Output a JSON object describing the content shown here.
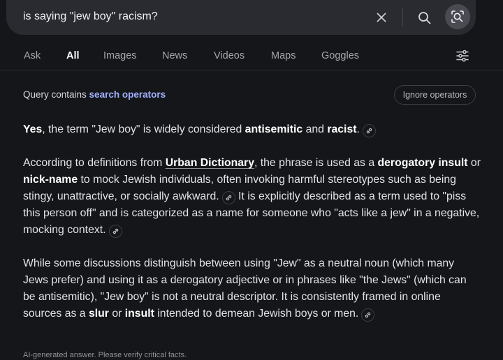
{
  "search": {
    "query": "is saying \"jew boy\" racism?",
    "icons": [
      "close-icon",
      "search-icon",
      "lens-icon"
    ]
  },
  "tabs": [
    {
      "label": "Ask",
      "active": false
    },
    {
      "label": "All",
      "active": true
    },
    {
      "label": "Images",
      "active": false
    },
    {
      "label": "News",
      "active": false
    },
    {
      "label": "Videos",
      "active": false
    },
    {
      "label": "Maps",
      "active": false
    },
    {
      "label": "Goggles",
      "active": false
    }
  ],
  "operators": {
    "prefix": "Query contains ",
    "link": "search operators",
    "ignore_button": "Ignore operators"
  },
  "answer": {
    "p1": {
      "s1": "Yes",
      "t1": ", the term \"Jew boy\" is widely considered ",
      "s2": "antisemitic",
      "t2": " and ",
      "s3": "racist",
      "t3": "."
    },
    "p2": {
      "t1": "According to definitions from ",
      "link": "Urban Dictionary",
      "t2": ", the phrase is used as a ",
      "s1": "derogatory insult",
      "t3": " or ",
      "s2": "nick-name",
      "t4": " to mock Jewish individuals, often invoking harmful stereotypes such as being stingy, unattractive, or socially awkward.",
      "t5": " It is explicitly described as a term used to \"piss this person off\" and is categorized as a name for someone who \"acts like a jew\" in a negative, mocking context."
    },
    "p3": {
      "t1": "While some discussions distinguish between using \"Jew\" as a neutral noun (which many Jews prefer) and using it as a derogatory adjective or in phrases like \"the Jews\" (which can be antisemitic), \"Jew boy\" is not a neutral descriptor. It is consistently framed in online sources as a ",
      "s1": "slur",
      "t2": " or ",
      "s2": "insult",
      "t3": " intended to demean Jewish boys or men."
    }
  },
  "footer": "AI-generated answer. Please verify critical facts.",
  "colors": {
    "background": "#151619",
    "search_bar": "#2a2b30",
    "link_accent": "#9fb1ff",
    "text": "#e2e3e7",
    "muted": "#a3a6ae"
  }
}
